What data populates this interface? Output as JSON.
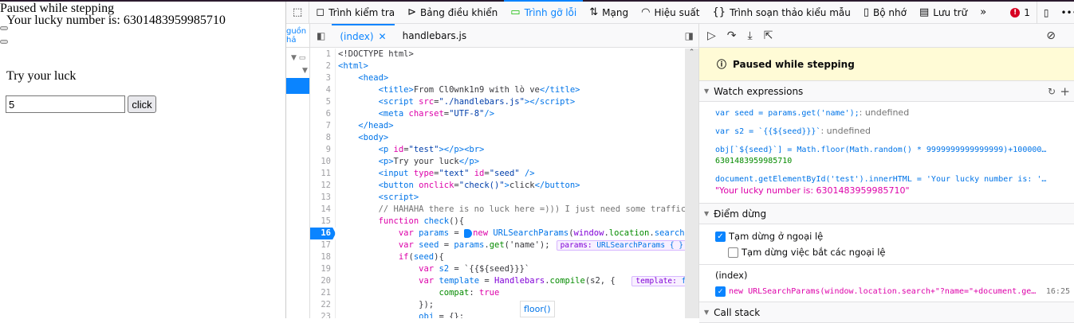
{
  "page": {
    "paused": "Paused while stepping",
    "lucky": "Your lucky number is: 6301483959985710",
    "try": "Try your luck",
    "input_value": "5",
    "button": "click"
  },
  "toolbar": {
    "items": [
      {
        "icon": "pick-element-icon",
        "glyph": "⬚",
        "label": ""
      },
      {
        "icon": "inspector-icon",
        "glyph": "◻",
        "label": "Trình kiểm tra"
      },
      {
        "icon": "console-icon",
        "glyph": "⊳",
        "label": "Bảng điều khiển"
      },
      {
        "icon": "debugger-icon",
        "glyph": "▭",
        "label": "Trình gỡ lỗi"
      },
      {
        "icon": "network-icon",
        "glyph": "⇅",
        "label": "Mạng"
      },
      {
        "icon": "performance-icon",
        "glyph": "◠",
        "label": "Hiệu suất"
      },
      {
        "icon": "style-editor-icon",
        "glyph": "{}",
        "label": "Trình soạn thảo kiểu mẫu"
      },
      {
        "icon": "memory-icon",
        "glyph": "▯",
        "label": "Bộ nhớ"
      },
      {
        "icon": "storage-icon",
        "glyph": "▤",
        "label": "Lưu trữ"
      },
      {
        "icon": "more-tools-icon",
        "glyph": "»",
        "label": ""
      }
    ],
    "error_count": "1",
    "selected": 3
  },
  "left_pane": {
    "tab_label": "guồn hả"
  },
  "editor": {
    "tabs": [
      "(index)",
      "handlebars.js"
    ],
    "breakpoint_line": 16,
    "lines": [
      [
        [
          "x",
          "<!DOCTYPE html>"
        ]
      ],
      [
        [
          "t",
          "<html>"
        ]
      ],
      [
        [
          "x",
          "    "
        ],
        [
          "t",
          "<head>"
        ]
      ],
      [
        [
          "x",
          "        "
        ],
        [
          "t",
          "<title>"
        ],
        [
          "x",
          "From Cl0wnk1n9 with lò ve"
        ],
        [
          "t",
          "</title>"
        ]
      ],
      [
        [
          "x",
          "        "
        ],
        [
          "t",
          "<script "
        ],
        [
          "a",
          "src"
        ],
        [
          "x",
          "="
        ],
        [
          "s",
          "\"./handlebars.js\""
        ],
        [
          "t",
          "></script>"
        ]
      ],
      [
        [
          "x",
          "        "
        ],
        [
          "t",
          "<meta "
        ],
        [
          "a",
          "charset"
        ],
        [
          "x",
          "="
        ],
        [
          "s",
          "\"UTF-8\""
        ],
        [
          "t",
          "/>"
        ]
      ],
      [
        [
          "x",
          "    "
        ],
        [
          "t",
          "</head>"
        ]
      ],
      [
        [
          "x",
          "    "
        ],
        [
          "t",
          "<body>"
        ]
      ],
      [
        [
          "x",
          "        "
        ],
        [
          "t",
          "<p "
        ],
        [
          "a",
          "id"
        ],
        [
          "x",
          "="
        ],
        [
          "s",
          "\"test\""
        ],
        [
          "t",
          "></p><br>"
        ]
      ],
      [
        [
          "x",
          "        "
        ],
        [
          "t",
          "<p>"
        ],
        [
          "x",
          "Try your luck"
        ],
        [
          "t",
          "</p>"
        ]
      ],
      [
        [
          "x",
          "        "
        ],
        [
          "t",
          "<input "
        ],
        [
          "a",
          "type"
        ],
        [
          "x",
          "="
        ],
        [
          "s",
          "\"text\" "
        ],
        [
          "a",
          "id"
        ],
        [
          "x",
          "="
        ],
        [
          "s",
          "\"seed\" "
        ],
        [
          "t",
          "/>"
        ]
      ],
      [
        [
          "x",
          "        "
        ],
        [
          "t",
          "<button "
        ],
        [
          "a",
          "onclick"
        ],
        [
          "x",
          "="
        ],
        [
          "s",
          "\"check()\""
        ],
        [
          "t",
          ">"
        ],
        [
          "x",
          "click"
        ],
        [
          "t",
          "</button>"
        ]
      ],
      [
        [
          "x",
          "        "
        ],
        [
          "t",
          "<script>"
        ]
      ],
      [
        [
          "x",
          "        "
        ],
        [
          "c",
          "// HAHAHA there is no luck here =))) I just need some traffic"
        ]
      ],
      [
        [
          "x",
          "        "
        ],
        [
          "k",
          "function "
        ],
        [
          "f",
          "check"
        ],
        [
          "x",
          "(){"
        ]
      ],
      [
        [
          "x",
          "            "
        ],
        [
          "k",
          "var "
        ],
        [
          "f",
          "params"
        ],
        [
          "x",
          " = "
        ],
        [
          "bpm",
          ""
        ],
        [
          "k",
          "new "
        ],
        [
          "f",
          "URLSearchParams"
        ],
        [
          "x",
          "("
        ],
        [
          "p",
          "window"
        ],
        [
          "x",
          "."
        ],
        [
          "g",
          "location"
        ],
        [
          "x",
          "."
        ],
        [
          "f",
          "search"
        ],
        [
          "x",
          "+\"?name=\"+document.ge"
        ]
      ],
      [
        [
          "x",
          "            "
        ],
        [
          "k",
          "var "
        ],
        [
          "f",
          "seed"
        ],
        [
          "x",
          " = "
        ],
        [
          "f",
          "params"
        ],
        [
          "x",
          "."
        ],
        [
          "g",
          "get"
        ],
        [
          "x",
          "('name');"
        ],
        [
          "pv",
          "params:|URLSearchParams { }"
        ]
      ],
      [
        [
          "x",
          "            "
        ],
        [
          "k",
          "if"
        ],
        [
          "x",
          "("
        ],
        [
          "f",
          "seed"
        ],
        [
          "x",
          "){"
        ]
      ],
      [
        [
          "x",
          "                "
        ],
        [
          "k",
          "var "
        ],
        [
          "f",
          "s2"
        ],
        [
          "x",
          " = `{{${seed}}}`"
        ]
      ],
      [
        [
          "x",
          "                "
        ],
        [
          "k",
          "var "
        ],
        [
          "f",
          "template"
        ],
        [
          "x",
          " = "
        ],
        [
          "p",
          "Handlebars"
        ],
        [
          "x",
          "."
        ],
        [
          "g",
          "compile"
        ],
        [
          "x",
          "(s2, {  "
        ],
        [
          "pv",
          "template:|function"
        ]
      ],
      [
        [
          "x",
          "                    "
        ],
        [
          "g",
          "compat"
        ],
        [
          "x",
          ": "
        ],
        [
          "k",
          "true"
        ]
      ],
      [
        [
          "x",
          "                "
        ],
        [
          "x",
          "});"
        ]
      ],
      [
        [
          "x",
          "                "
        ],
        [
          "f",
          "obj"
        ],
        [
          "x",
          " = {};"
        ]
      ]
    ],
    "hover_tooltip": "floor()"
  },
  "right_panel": {
    "banner": "Paused while stepping",
    "watch": {
      "title": "Watch expressions",
      "items": [
        {
          "expr": "var seed = params.get('name');",
          "sep": ": ",
          "value": "undefined",
          "kind": "u"
        },
        {
          "expr": "var s2 = `{{${seed}}}`",
          "sep": ": ",
          "value": "undefined",
          "kind": "u"
        },
        {
          "expr": "obj[`${seed}`] = Math.floor(Math.random() * 9999999999999999)+100000…",
          "sep": "",
          "value": "6301483959985710",
          "kind": "n"
        },
        {
          "expr": "document.getElementById('test').innerHTML = 'Your lucky number is: '…",
          "sep": "",
          "value": "\"Your lucky number is: 6301483959985710\"",
          "kind": "str"
        }
      ]
    },
    "breakpoints": {
      "title": "Điểm dừng",
      "pause_exceptions": "Tạm dừng ở ngoại lệ",
      "pause_caught": "Tạm dừng việc bắt các ngoại lệ",
      "file": "(index)",
      "bp_code": "new URLSearchParams(window.location.search+\"?name=\"+document.ge…",
      "bp_loc": "16:25"
    },
    "callstack": {
      "title": "Call stack"
    }
  },
  "colors": {
    "accent": "#0a84ff",
    "banner": "#fffbd6"
  }
}
